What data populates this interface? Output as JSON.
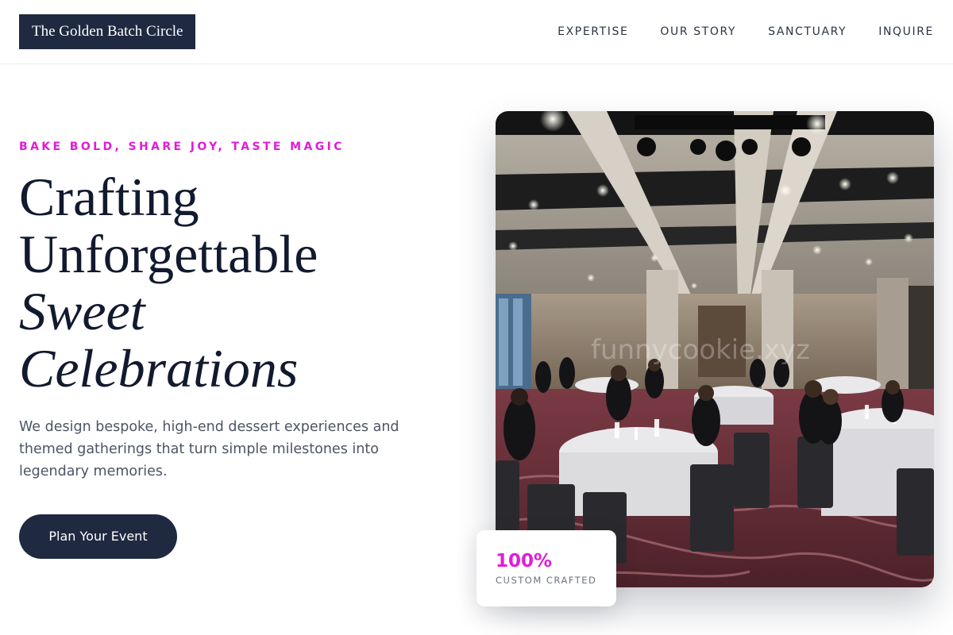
{
  "header": {
    "brand": "The Golden Batch Circle",
    "nav": [
      "EXPERTISE",
      "OUR STORY",
      "SANCTUARY",
      "INQUIRE"
    ]
  },
  "hero": {
    "tagline": "BAKE BOLD, SHARE JOY, TASTE MAGIC",
    "headline": {
      "line1": "Crafting",
      "line2": "Unforgettable",
      "line3": "Sweet",
      "line4": "Celebrations"
    },
    "description": "We design bespoke, high-end dessert experiences and themed gatherings that turn simple milestones into legendary memories.",
    "cta_label": "Plan Your Event"
  },
  "image": {
    "subject": "banquet-hall-photo",
    "watermark": "funnycookie.xyz"
  },
  "stat": {
    "value": "100%",
    "label": "CUSTOM CRAFTED"
  },
  "colors": {
    "accent": "#e11cd7",
    "navy": "#1f2940",
    "text": "#111a2e",
    "muted": "#4b5566"
  }
}
